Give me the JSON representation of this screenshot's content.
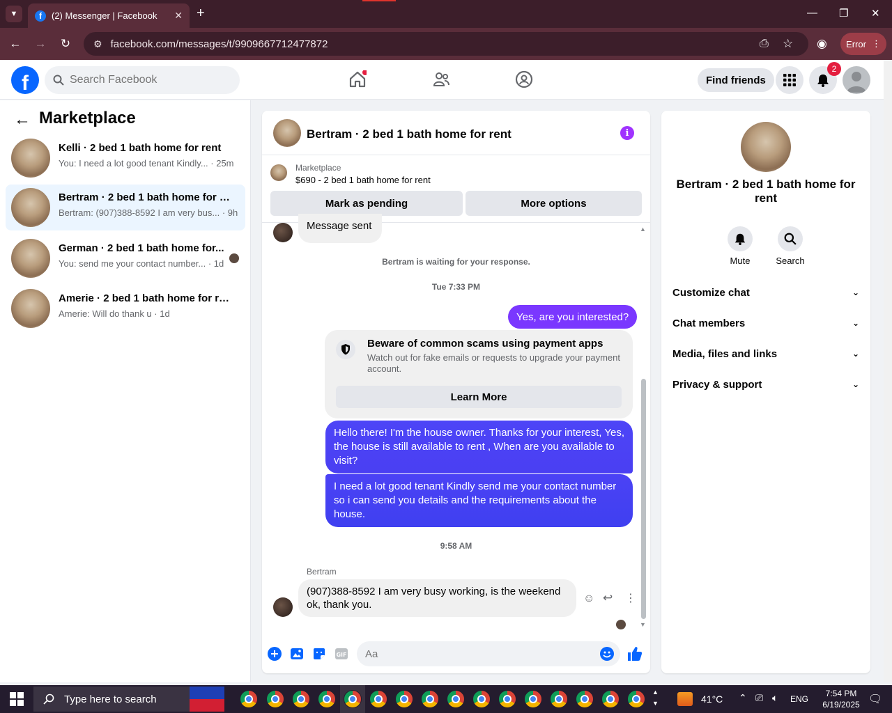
{
  "browser": {
    "tab_title": "(2) Messenger | Facebook",
    "url": "facebook.com/messages/t/9909667712477872",
    "error_label": "Error"
  },
  "header": {
    "search_placeholder": "Search Facebook",
    "find_friends": "Find friends",
    "notification_count": "2"
  },
  "sidebar": {
    "title": "Marketplace",
    "conversations": [
      {
        "title": "Kelli · 2 bed 1 bath home for rent",
        "preview": "You: I need a lot good tenant Kindly... · 25m"
      },
      {
        "title": "Bertram · 2 bed 1 bath home for re...",
        "preview": "Bertram: (907)388-8592 I am very bus... · 9h"
      },
      {
        "title": "German · 2 bed 1 bath home for...",
        "preview": "You: send me your contact number... · 1d"
      },
      {
        "title": "Amerie · 2 bed 1 bath home for rent",
        "preview": "Amerie: Will do thank u · 1d"
      }
    ]
  },
  "chat": {
    "title": "Bertram · 2 bed 1 bath home for rent",
    "marketplace_label": "Marketplace",
    "listing": "$690 - 2 bed 1 bath home for rent",
    "mark_pending": "Mark as pending",
    "more_options": "More options",
    "message_sent": "Message sent",
    "waiting": "Bertram is waiting for your response.",
    "time1": "Tue 7:33 PM",
    "msg_interested": "Yes, are you interested?",
    "scam_title": "Beware of common scams using payment apps",
    "scam_body": "Watch out for fake emails or requests to upgrade your payment account.",
    "learn_more": "Learn More",
    "msg_owner": "Hello there! I'm the house owner. Thanks for your interest, Yes, the house is still available to rent , When are you available to visit?",
    "msg_tenant": "I need a lot good tenant Kindly send me your contact number so i can send you details and the requirements about the house.",
    "time2": "9:58 AM",
    "sender_name": "Bertram",
    "msg_reply": "(907)388-8592 I am very busy working, is the weekend ok, thank you.",
    "composer_placeholder": "Aa"
  },
  "right_panel": {
    "name": "Bertram · 2 bed 1 bath home for rent",
    "mute": "Mute",
    "search": "Search",
    "sections": [
      "Customize chat",
      "Chat members",
      "Media, files and links",
      "Privacy & support"
    ]
  },
  "taskbar": {
    "search_placeholder": "Type here to search",
    "temperature": "41°C",
    "language": "ENG",
    "time": "7:54 PM",
    "date": "6/19/2025"
  },
  "colors": {
    "fb_blue": "#0866ff",
    "outgoing_purple": "#7a37ff",
    "outgoing_blue": "#4f3cf5",
    "browser_frame": "#5a2d3a"
  }
}
